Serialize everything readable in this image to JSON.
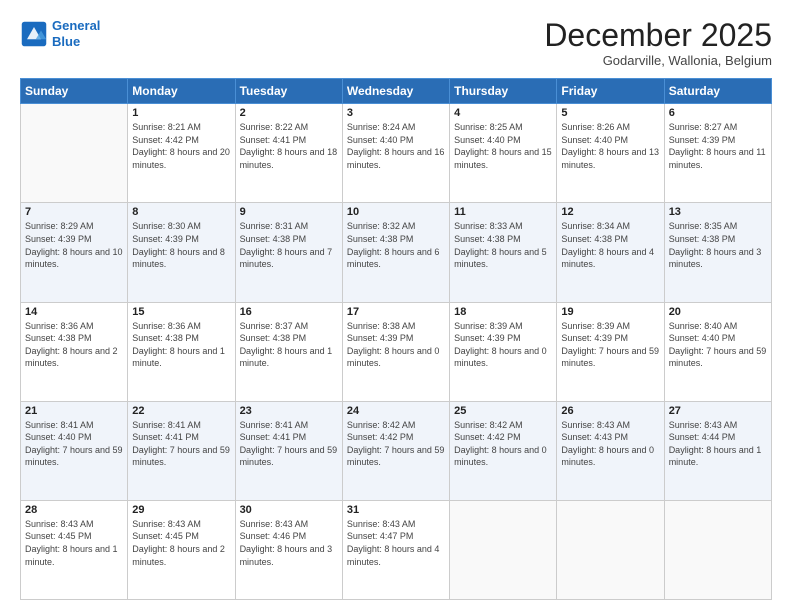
{
  "logo": {
    "line1": "General",
    "line2": "Blue"
  },
  "title": "December 2025",
  "location": "Godarville, Wallonia, Belgium",
  "days_header": [
    "Sunday",
    "Monday",
    "Tuesday",
    "Wednesday",
    "Thursday",
    "Friday",
    "Saturday"
  ],
  "weeks": [
    [
      {
        "day": "",
        "sunrise": "",
        "sunset": "",
        "daylight": ""
      },
      {
        "day": "1",
        "sunrise": "Sunrise: 8:21 AM",
        "sunset": "Sunset: 4:42 PM",
        "daylight": "Daylight: 8 hours and 20 minutes."
      },
      {
        "day": "2",
        "sunrise": "Sunrise: 8:22 AM",
        "sunset": "Sunset: 4:41 PM",
        "daylight": "Daylight: 8 hours and 18 minutes."
      },
      {
        "day": "3",
        "sunrise": "Sunrise: 8:24 AM",
        "sunset": "Sunset: 4:40 PM",
        "daylight": "Daylight: 8 hours and 16 minutes."
      },
      {
        "day": "4",
        "sunrise": "Sunrise: 8:25 AM",
        "sunset": "Sunset: 4:40 PM",
        "daylight": "Daylight: 8 hours and 15 minutes."
      },
      {
        "day": "5",
        "sunrise": "Sunrise: 8:26 AM",
        "sunset": "Sunset: 4:40 PM",
        "daylight": "Daylight: 8 hours and 13 minutes."
      },
      {
        "day": "6",
        "sunrise": "Sunrise: 8:27 AM",
        "sunset": "Sunset: 4:39 PM",
        "daylight": "Daylight: 8 hours and 11 minutes."
      }
    ],
    [
      {
        "day": "7",
        "sunrise": "Sunrise: 8:29 AM",
        "sunset": "Sunset: 4:39 PM",
        "daylight": "Daylight: 8 hours and 10 minutes."
      },
      {
        "day": "8",
        "sunrise": "Sunrise: 8:30 AM",
        "sunset": "Sunset: 4:39 PM",
        "daylight": "Daylight: 8 hours and 8 minutes."
      },
      {
        "day": "9",
        "sunrise": "Sunrise: 8:31 AM",
        "sunset": "Sunset: 4:38 PM",
        "daylight": "Daylight: 8 hours and 7 minutes."
      },
      {
        "day": "10",
        "sunrise": "Sunrise: 8:32 AM",
        "sunset": "Sunset: 4:38 PM",
        "daylight": "Daylight: 8 hours and 6 minutes."
      },
      {
        "day": "11",
        "sunrise": "Sunrise: 8:33 AM",
        "sunset": "Sunset: 4:38 PM",
        "daylight": "Daylight: 8 hours and 5 minutes."
      },
      {
        "day": "12",
        "sunrise": "Sunrise: 8:34 AM",
        "sunset": "Sunset: 4:38 PM",
        "daylight": "Daylight: 8 hours and 4 minutes."
      },
      {
        "day": "13",
        "sunrise": "Sunrise: 8:35 AM",
        "sunset": "Sunset: 4:38 PM",
        "daylight": "Daylight: 8 hours and 3 minutes."
      }
    ],
    [
      {
        "day": "14",
        "sunrise": "Sunrise: 8:36 AM",
        "sunset": "Sunset: 4:38 PM",
        "daylight": "Daylight: 8 hours and 2 minutes."
      },
      {
        "day": "15",
        "sunrise": "Sunrise: 8:36 AM",
        "sunset": "Sunset: 4:38 PM",
        "daylight": "Daylight: 8 hours and 1 minute."
      },
      {
        "day": "16",
        "sunrise": "Sunrise: 8:37 AM",
        "sunset": "Sunset: 4:38 PM",
        "daylight": "Daylight: 8 hours and 1 minute."
      },
      {
        "day": "17",
        "sunrise": "Sunrise: 8:38 AM",
        "sunset": "Sunset: 4:39 PM",
        "daylight": "Daylight: 8 hours and 0 minutes."
      },
      {
        "day": "18",
        "sunrise": "Sunrise: 8:39 AM",
        "sunset": "Sunset: 4:39 PM",
        "daylight": "Daylight: 8 hours and 0 minutes."
      },
      {
        "day": "19",
        "sunrise": "Sunrise: 8:39 AM",
        "sunset": "Sunset: 4:39 PM",
        "daylight": "Daylight: 7 hours and 59 minutes."
      },
      {
        "day": "20",
        "sunrise": "Sunrise: 8:40 AM",
        "sunset": "Sunset: 4:40 PM",
        "daylight": "Daylight: 7 hours and 59 minutes."
      }
    ],
    [
      {
        "day": "21",
        "sunrise": "Sunrise: 8:41 AM",
        "sunset": "Sunset: 4:40 PM",
        "daylight": "Daylight: 7 hours and 59 minutes."
      },
      {
        "day": "22",
        "sunrise": "Sunrise: 8:41 AM",
        "sunset": "Sunset: 4:41 PM",
        "daylight": "Daylight: 7 hours and 59 minutes."
      },
      {
        "day": "23",
        "sunrise": "Sunrise: 8:41 AM",
        "sunset": "Sunset: 4:41 PM",
        "daylight": "Daylight: 7 hours and 59 minutes."
      },
      {
        "day": "24",
        "sunrise": "Sunrise: 8:42 AM",
        "sunset": "Sunset: 4:42 PM",
        "daylight": "Daylight: 7 hours and 59 minutes."
      },
      {
        "day": "25",
        "sunrise": "Sunrise: 8:42 AM",
        "sunset": "Sunset: 4:42 PM",
        "daylight": "Daylight: 8 hours and 0 minutes."
      },
      {
        "day": "26",
        "sunrise": "Sunrise: 8:43 AM",
        "sunset": "Sunset: 4:43 PM",
        "daylight": "Daylight: 8 hours and 0 minutes."
      },
      {
        "day": "27",
        "sunrise": "Sunrise: 8:43 AM",
        "sunset": "Sunset: 4:44 PM",
        "daylight": "Daylight: 8 hours and 1 minute."
      }
    ],
    [
      {
        "day": "28",
        "sunrise": "Sunrise: 8:43 AM",
        "sunset": "Sunset: 4:45 PM",
        "daylight": "Daylight: 8 hours and 1 minute."
      },
      {
        "day": "29",
        "sunrise": "Sunrise: 8:43 AM",
        "sunset": "Sunset: 4:45 PM",
        "daylight": "Daylight: 8 hours and 2 minutes."
      },
      {
        "day": "30",
        "sunrise": "Sunrise: 8:43 AM",
        "sunset": "Sunset: 4:46 PM",
        "daylight": "Daylight: 8 hours and 3 minutes."
      },
      {
        "day": "31",
        "sunrise": "Sunrise: 8:43 AM",
        "sunset": "Sunset: 4:47 PM",
        "daylight": "Daylight: 8 hours and 4 minutes."
      },
      {
        "day": "",
        "sunrise": "",
        "sunset": "",
        "daylight": ""
      },
      {
        "day": "",
        "sunrise": "",
        "sunset": "",
        "daylight": ""
      },
      {
        "day": "",
        "sunrise": "",
        "sunset": "",
        "daylight": ""
      }
    ]
  ]
}
